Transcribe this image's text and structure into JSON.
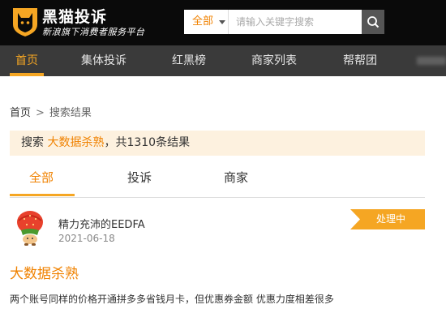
{
  "header": {
    "logo_title": "黑猫投诉",
    "logo_subtitle": "新浪旗下消费者服务平台",
    "search": {
      "category": "全部",
      "placeholder": "请输入关键字搜索",
      "value": ""
    }
  },
  "nav": {
    "items": [
      {
        "label": "首页",
        "active": true
      },
      {
        "label": "集体投诉",
        "active": false
      },
      {
        "label": "红黑榜",
        "active": false
      },
      {
        "label": "商家列表",
        "active": false
      },
      {
        "label": "帮帮团",
        "active": false
      }
    ]
  },
  "breadcrumb": {
    "home": "首页",
    "separator": ">",
    "current": "搜索结果"
  },
  "results": {
    "prefix": "搜索",
    "keyword": "大数据杀熟",
    "suffix": "，共1310条结果"
  },
  "tabs": [
    {
      "label": "全部",
      "active": true
    },
    {
      "label": "投诉",
      "active": false
    },
    {
      "label": "商家",
      "active": false
    }
  ],
  "complaint": {
    "user_name": "精力充沛的EEDFA",
    "date": "2021-06-18",
    "status": "处理中",
    "title": "大数据杀熟",
    "body": "两个账号同样的价格开通拼多多省钱月卡，但优惠券金额 优惠力度相差很多"
  },
  "colors": {
    "accent": "#f08200",
    "status_badge": "#f5a623",
    "header_bg": "#0a0a0a",
    "nav_bg": "#3a3a3a",
    "result_bar_bg": "#fdf1df"
  },
  "icons": {
    "logo": "cat-logo-icon",
    "search": "search-icon",
    "dropdown": "chevron-down-icon",
    "avatar": "strawberry-avatar"
  }
}
